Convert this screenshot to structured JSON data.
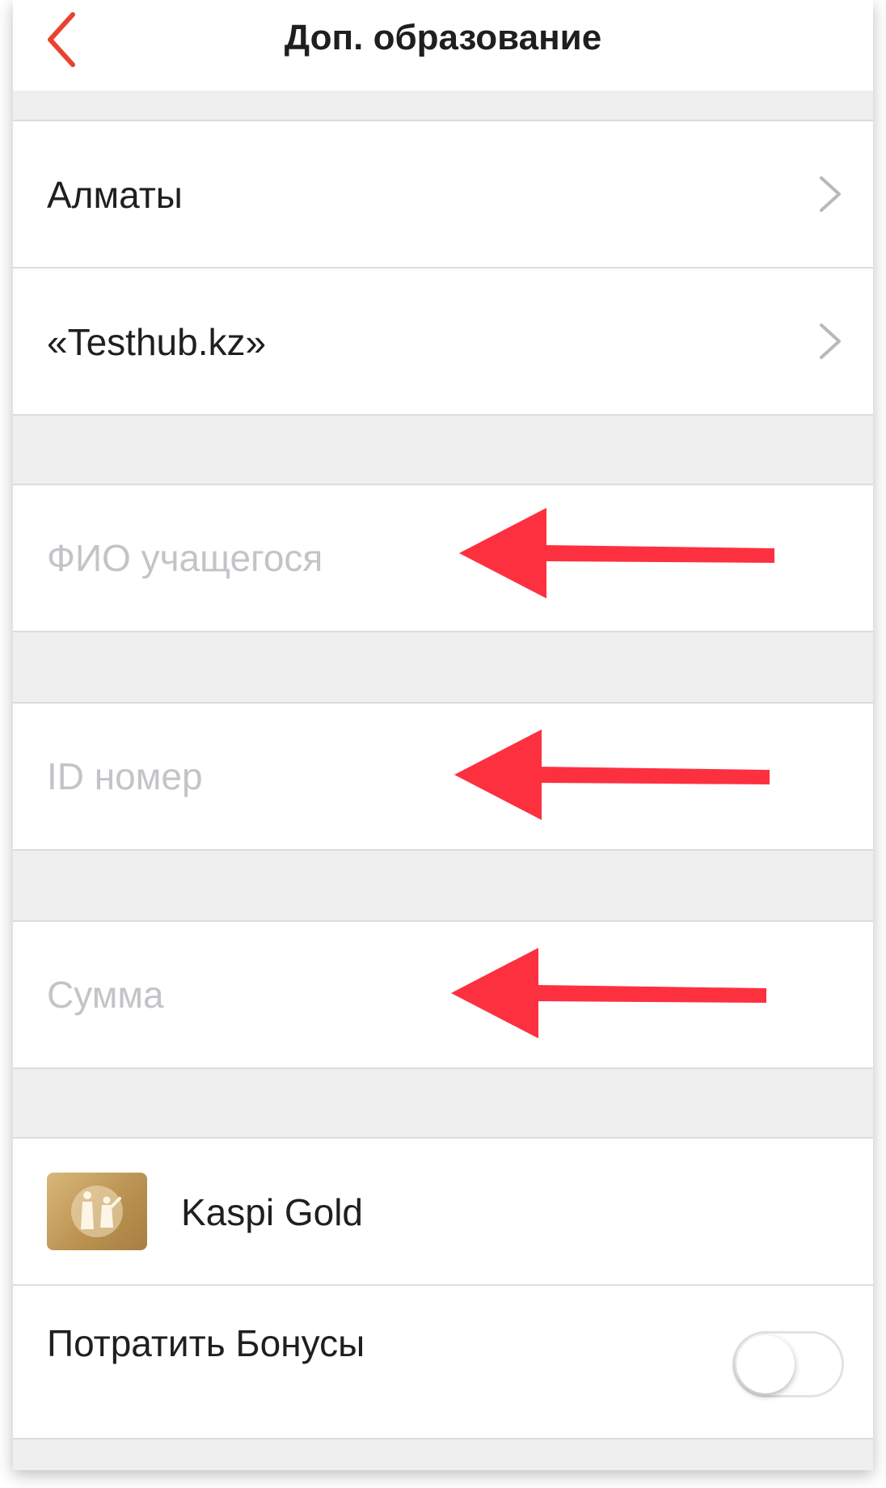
{
  "header": {
    "title": "Доп. образование",
    "back_icon": "chevron-left-icon",
    "accent_color": "#e8432e"
  },
  "selectors": [
    {
      "label": "Алматы"
    },
    {
      "label": "«Testhub.kz»"
    }
  ],
  "inputs": {
    "student_name": {
      "placeholder": "ФИО учащегося",
      "value": ""
    },
    "id_number": {
      "placeholder": "ID номер",
      "value": ""
    },
    "amount": {
      "placeholder": "Сумма",
      "value": ""
    }
  },
  "payment": {
    "method": "Kaspi Gold"
  },
  "bonuses": {
    "label": "Потратить Бонусы",
    "enabled": false
  },
  "annotation_color": "#fd3040"
}
